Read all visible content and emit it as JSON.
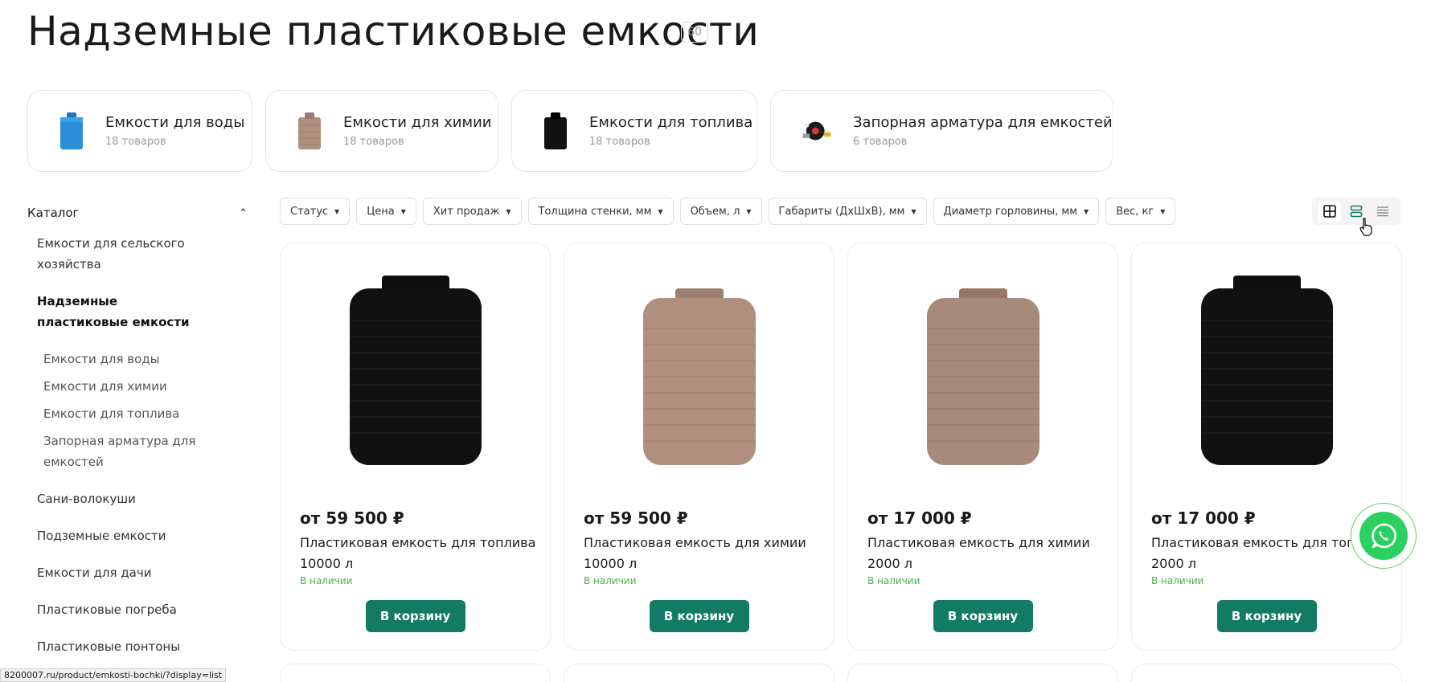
{
  "page": {
    "title": "Надземные пластиковые емкости",
    "count": "60"
  },
  "categories": [
    {
      "name": "Емкости для воды",
      "count": "18 товаров",
      "icon": "blue-tank-icon",
      "color": "#2a8fd6"
    },
    {
      "name": "Емкости для химии",
      "count": "18 товаров",
      "icon": "beige-tank-icon",
      "color": "#b08f80"
    },
    {
      "name": "Емкости для топлива",
      "count": "18 товаров",
      "icon": "black-tank-icon",
      "color": "#121212"
    },
    {
      "name": "Запорная арматура для емкостей",
      "count": "6 товаров",
      "icon": "valve-fittings-icon",
      "color": "#222222"
    }
  ],
  "sidebar": {
    "title": "Каталог",
    "items": [
      {
        "label": "Емкости для сельского хозяйства",
        "level": 1
      },
      {
        "label": "Надземные пластиковые емкости",
        "level": 1,
        "active": true
      },
      {
        "label": "Емкости для воды",
        "level": 2
      },
      {
        "label": "Емкости для химии",
        "level": 2
      },
      {
        "label": "Емкости для топлива",
        "level": 2
      },
      {
        "label": "Запорная арматура для емкостей",
        "level": 2
      },
      {
        "label": "Сани-волокуши",
        "level": 1
      },
      {
        "label": "Подземные емкости",
        "level": 1
      },
      {
        "label": "Емкости для дачи",
        "level": 1
      },
      {
        "label": "Пластиковые погреба",
        "level": 1
      },
      {
        "label": "Пластиковые понтоны",
        "level": 1
      }
    ]
  },
  "filters": [
    "Статус",
    "Цена",
    "Хит продаж",
    "Толщина стенки, мм",
    "Объем, л",
    "Габариты (ДхШхВ), мм",
    "Диаметр горловины, мм",
    "Вес, кг"
  ],
  "view_modes": {
    "options": [
      "grid-view-icon",
      "list-view-icon",
      "table-view-icon"
    ],
    "selected": "grid-view-icon"
  },
  "products": [
    {
      "price": "от 59 500 ₽",
      "name": "Пластиковая емкость для топлива 10000 л",
      "stock": "В наличии",
      "button": "В корзину",
      "color": "#111111"
    },
    {
      "price": "от 59 500 ₽",
      "name": "Пластиковая емкость для химии 10000 л",
      "stock": "В наличии",
      "button": "В корзину",
      "color": "#b08f80"
    },
    {
      "price": "от 17 000 ₽",
      "name": "Пластиковая емкость для химии 2000 л",
      "stock": "В наличии",
      "button": "В корзину",
      "color": "#a88a7c"
    },
    {
      "price": "от 17 000 ₽",
      "name": "Пластиковая емкость для топлива 2000 л",
      "stock": "В наличии",
      "button": "В корзину",
      "color": "#111111"
    }
  ],
  "colors": {
    "accent": "#137a63",
    "stock": "#4caf50",
    "whatsapp": "#2bd160"
  },
  "statusbar": {
    "url": "8200007.ru/product/emkosti-bochki/?display=list"
  }
}
